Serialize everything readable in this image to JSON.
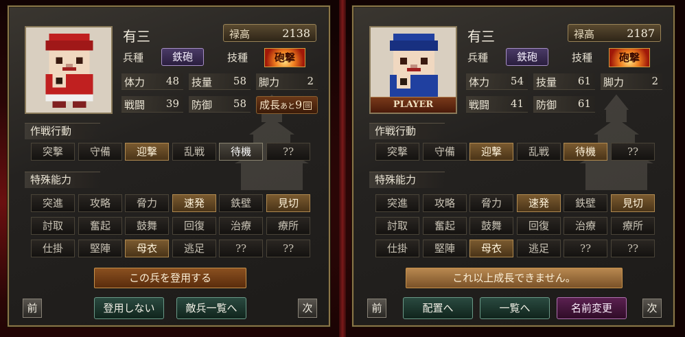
{
  "left": {
    "name": "有三",
    "stipend_label": "禄高",
    "stipend_value": "2138",
    "unit_type_label": "兵種",
    "unit_type": "鉄砲",
    "skill_label": "技種",
    "skill": "砲撃",
    "stats": {
      "hp_label": "体力",
      "hp": "48",
      "tech_label": "技量",
      "tech": "58",
      "leg_label": "脚力",
      "leg": "2",
      "atk_label": "戦闘",
      "atk": "39",
      "def_label": "防御",
      "def": "58"
    },
    "growth": {
      "prefix": "成長",
      "small": "あと",
      "num": "9",
      "icon": "回"
    },
    "tactics_title": "作戦行動",
    "tactics": [
      "突撃",
      "守備",
      "迎撃",
      "乱戦",
      "待機",
      "??"
    ],
    "abilities_title": "特殊能力",
    "abilities": [
      "突進",
      "攻略",
      "脅力",
      "速発",
      "鉄壁",
      "見切",
      "討取",
      "奮起",
      "鼓舞",
      "回復",
      "治療",
      "療所",
      "仕掛",
      "堅陣",
      "母衣",
      "逃足",
      "??",
      "??"
    ],
    "action_main": "この兵を登用する",
    "prev": "前",
    "next": "次",
    "btn_a": "登用しない",
    "btn_b": "敵兵一覧へ"
  },
  "right": {
    "name": "有三",
    "stipend_label": "禄高",
    "stipend_value": "2187",
    "unit_type_label": "兵種",
    "unit_type": "鉄砲",
    "skill_label": "技種",
    "skill": "砲撃",
    "player_tag": "PLAYER",
    "stats": {
      "hp_label": "体力",
      "hp": "54",
      "tech_label": "技量",
      "tech": "61",
      "leg_label": "脚力",
      "leg": "2",
      "atk_label": "戦闘",
      "atk": "41",
      "def_label": "防御",
      "def": "61"
    },
    "tactics_title": "作戦行動",
    "tactics": [
      "突撃",
      "守備",
      "迎撃",
      "乱戦",
      "待機",
      "??"
    ],
    "abilities_title": "特殊能力",
    "abilities": [
      "突進",
      "攻略",
      "脅力",
      "速発",
      "鉄壁",
      "見切",
      "討取",
      "奮起",
      "鼓舞",
      "回復",
      "治療",
      "療所",
      "仕掛",
      "堅陣",
      "母衣",
      "逃足",
      "??",
      "??"
    ],
    "status_msg": "これ以上成長できません。",
    "prev": "前",
    "next": "次",
    "btn_a": "配置へ",
    "btn_b": "一覧へ",
    "btn_c": "名前変更"
  },
  "colors": {
    "frame": "#8a7648",
    "active_button": "#7a5a30",
    "enemy_tunic": "#c02020",
    "player_tunic": "#2040a0"
  }
}
